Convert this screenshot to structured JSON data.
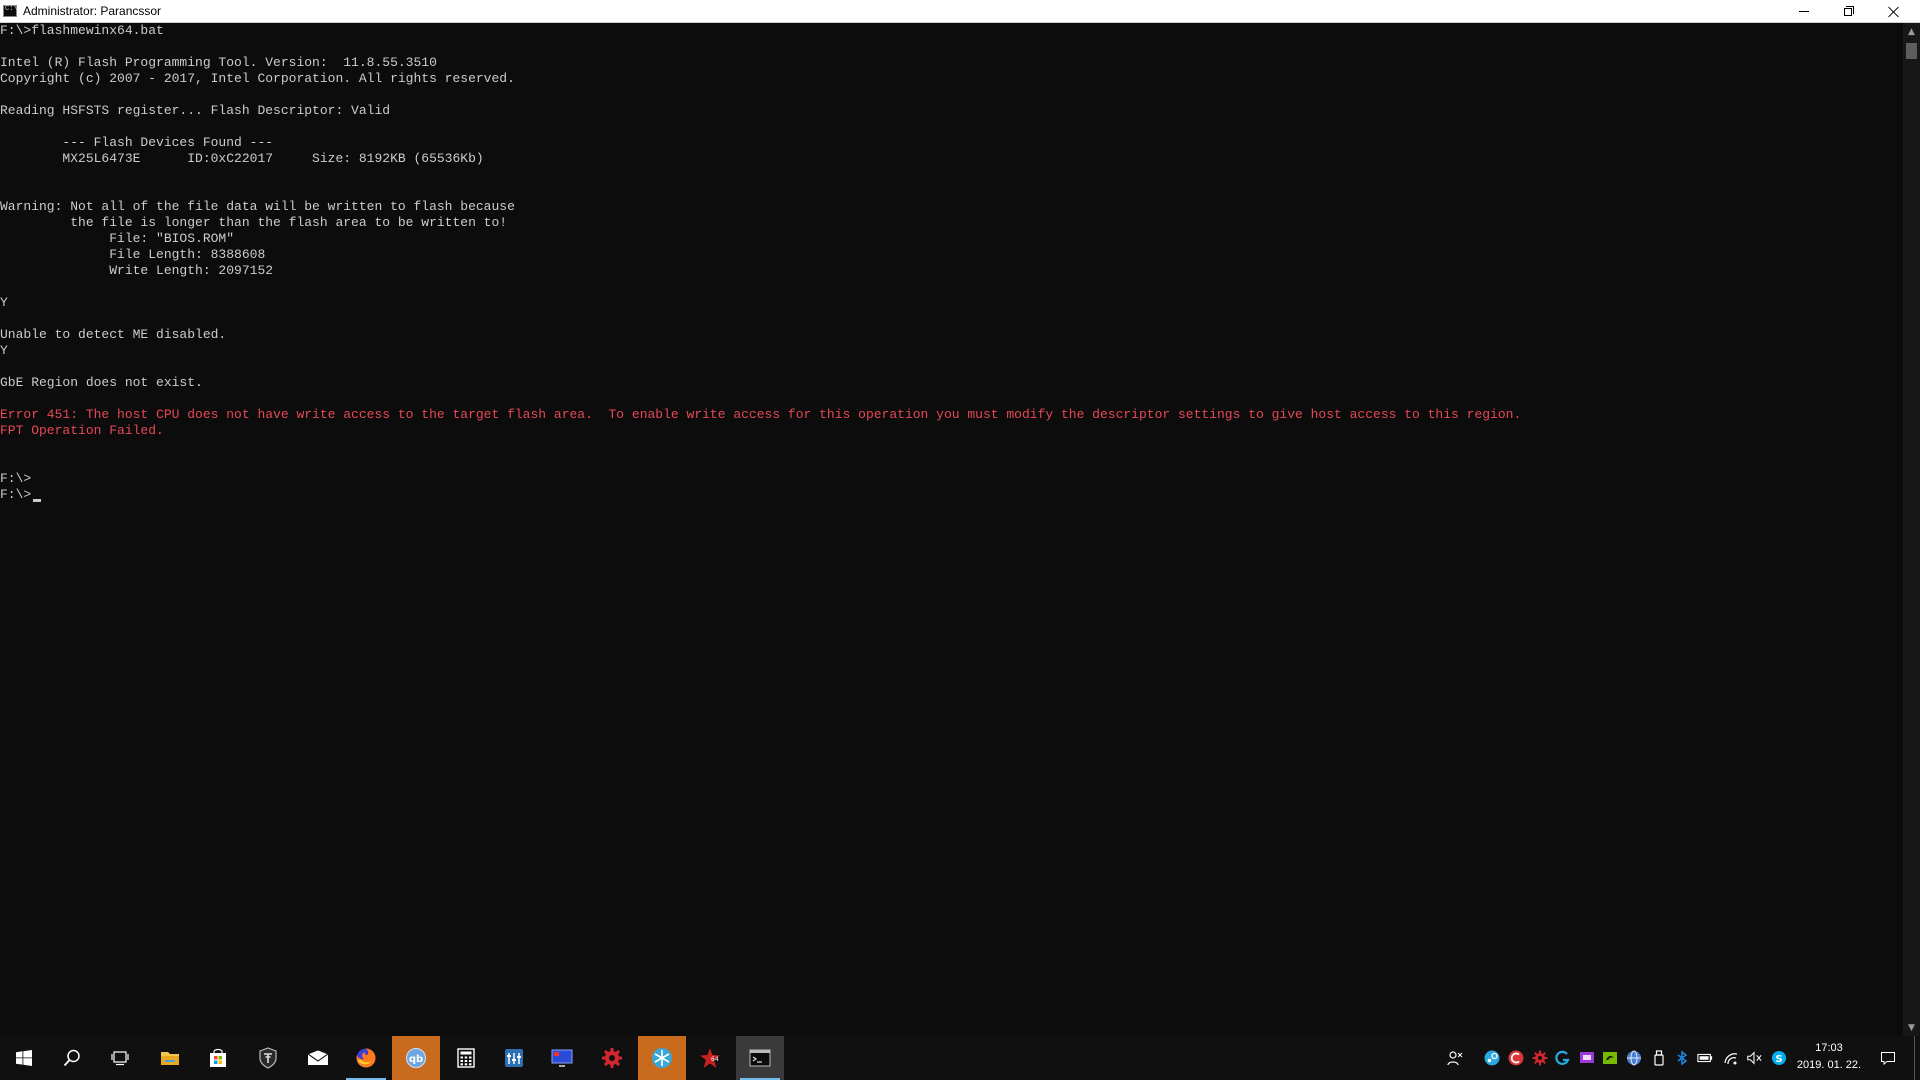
{
  "window": {
    "title": "Administrator: Parancssor"
  },
  "console": {
    "lines": [
      {
        "text": "F:\\>flashmewinx64.bat",
        "type": "normal"
      },
      {
        "text": "",
        "type": "normal"
      },
      {
        "text": "Intel (R) Flash Programming Tool. Version:  11.8.55.3510",
        "type": "normal"
      },
      {
        "text": "Copyright (c) 2007 - 2017, Intel Corporation. All rights reserved.",
        "type": "normal"
      },
      {
        "text": "",
        "type": "normal"
      },
      {
        "text": "Reading HSFSTS register... Flash Descriptor: Valid",
        "type": "normal"
      },
      {
        "text": "",
        "type": "normal"
      },
      {
        "text": "        --- Flash Devices Found ---",
        "type": "normal"
      },
      {
        "text": "        MX25L6473E      ID:0xC22017     Size: 8192KB (65536Kb)",
        "type": "normal"
      },
      {
        "text": "",
        "type": "normal"
      },
      {
        "text": "",
        "type": "normal"
      },
      {
        "text": "Warning: Not all of the file data will be written to flash because",
        "type": "normal"
      },
      {
        "text": "         the file is longer than the flash area to be written to!",
        "type": "normal"
      },
      {
        "text": "              File: \"BIOS.ROM\"",
        "type": "normal"
      },
      {
        "text": "              File Length: 8388608",
        "type": "normal"
      },
      {
        "text": "              Write Length: 2097152",
        "type": "normal"
      },
      {
        "text": "",
        "type": "normal"
      },
      {
        "text": "Y",
        "type": "normal"
      },
      {
        "text": "",
        "type": "normal"
      },
      {
        "text": "Unable to detect ME disabled.",
        "type": "normal"
      },
      {
        "text": "Y",
        "type": "normal"
      },
      {
        "text": "",
        "type": "normal"
      },
      {
        "text": "GbE Region does not exist.",
        "type": "normal"
      },
      {
        "text": "",
        "type": "normal"
      },
      {
        "text": "Error 451: The host CPU does not have write access to the target flash area.  To enable write access for this operation you must modify the descriptor settings to give host access to this region.",
        "type": "error"
      },
      {
        "text": "FPT Operation Failed.",
        "type": "error"
      },
      {
        "text": "",
        "type": "normal"
      },
      {
        "text": "",
        "type": "normal"
      },
      {
        "text": "F:\\>",
        "type": "normal"
      },
      {
        "text": "F:\\>",
        "type": "normal"
      }
    ]
  },
  "taskbar": {
    "apps": [
      {
        "name": "start-button",
        "icon": "windows-logo-icon",
        "state": "none"
      },
      {
        "name": "search-button",
        "icon": "search-icon",
        "state": "none"
      },
      {
        "name": "task-view-button",
        "icon": "task-view-icon",
        "state": "none"
      },
      {
        "name": "file-explorer-button",
        "icon": "folder-icon",
        "state": "none"
      },
      {
        "name": "store-button",
        "icon": "store-bag-icon",
        "state": "none"
      },
      {
        "name": "world-of-tanks-button",
        "icon": "tank-shield-icon",
        "state": "none"
      },
      {
        "name": "mail-button",
        "icon": "envelope-icon",
        "state": "none"
      },
      {
        "name": "firefox-button",
        "icon": "firefox-icon",
        "state": "running"
      },
      {
        "name": "qbittorrent-button",
        "icon": "qbittorrent-icon",
        "state": "orange"
      },
      {
        "name": "calculator-button",
        "icon": "calculator-icon",
        "state": "none"
      },
      {
        "name": "equalizer-app-button",
        "icon": "equalizer-icon",
        "state": "none"
      },
      {
        "name": "remote-desktop-button",
        "icon": "monitor-icon",
        "state": "none"
      },
      {
        "name": "settings-app-button",
        "icon": "red-gear-icon",
        "state": "none"
      },
      {
        "name": "snowflake-app-button",
        "icon": "snowflake-icon",
        "state": "orange"
      },
      {
        "name": "gaming-app-button",
        "icon": "red-star-icon",
        "state": "none"
      },
      {
        "name": "command-prompt-button",
        "icon": "terminal-icon",
        "state": "focused"
      }
    ],
    "tray_icons": [
      "people-icon",
      "steam-icon",
      "ccleaner-icon",
      "red-gear-tray-icon",
      "logitech-icon",
      "purple-app-icon",
      "nvidia-icon",
      "wifi-globe-icon",
      "usb-drive-icon",
      "bluetooth-icon",
      "battery-icon",
      "network-icon",
      "volume-muted-icon",
      "skype-icon"
    ],
    "clock": {
      "time": "17:03",
      "date": "2019. 01. 22."
    }
  },
  "colors": {
    "console_bg": "#0c0c0c",
    "console_text": "#cccccc",
    "error_text": "#e74856",
    "taskbar_bg": "#101010",
    "accent_orange": "#c96b1d",
    "running_indicator": "#76b9ed"
  }
}
